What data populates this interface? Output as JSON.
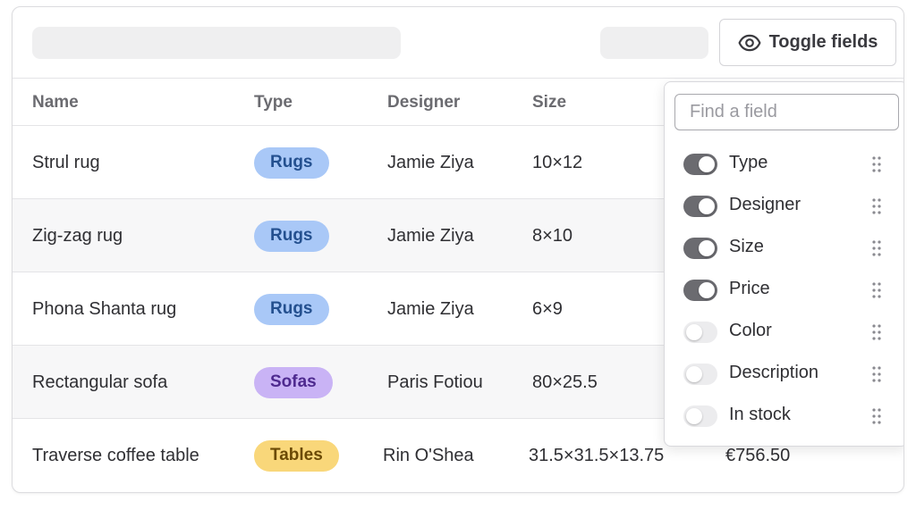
{
  "toolbar": {
    "toggle_label": "Toggle fields",
    "toggle_icon": "eye-icon"
  },
  "table": {
    "headers": [
      "Name",
      "Type",
      "Designer",
      "Size"
    ],
    "rows": [
      {
        "name": "Strul rug",
        "type": "Rugs",
        "designer": "Jamie Ziya",
        "size": "10×12",
        "price": ""
      },
      {
        "name": "Zig-zag rug",
        "type": "Rugs",
        "designer": "Jamie Ziya",
        "size": "8×10",
        "price": ""
      },
      {
        "name": "Phona Shanta rug",
        "type": "Rugs",
        "designer": "Jamie Ziya",
        "size": "6×9",
        "price": ""
      },
      {
        "name": "Rectangular sofa",
        "type": "Sofas",
        "designer": "Paris Fotiou",
        "size": "80×25.5",
        "price": ""
      },
      {
        "name": "Traverse coffee table",
        "type": "Tables",
        "designer": "Rin O'Shea",
        "size": "31.5×31.5×13.75",
        "price": "€756.50"
      }
    ]
  },
  "badge_colors": {
    "Rugs": {
      "bg": "#a9c8f7",
      "fg": "#24508f"
    },
    "Sofas": {
      "bg": "#c9b3f5",
      "fg": "#4e2a8f"
    },
    "Tables": {
      "bg": "#f9d77a",
      "fg": "#6b4a05"
    }
  },
  "field_picker": {
    "search_placeholder": "Find a field",
    "fields": [
      {
        "label": "Type",
        "enabled": true
      },
      {
        "label": "Designer",
        "enabled": true
      },
      {
        "label": "Size",
        "enabled": true
      },
      {
        "label": "Price",
        "enabled": true
      },
      {
        "label": "Color",
        "enabled": false
      },
      {
        "label": "Description",
        "enabled": false
      },
      {
        "label": "In stock",
        "enabled": false
      }
    ],
    "drag_icon": "drag-handle-icon"
  }
}
